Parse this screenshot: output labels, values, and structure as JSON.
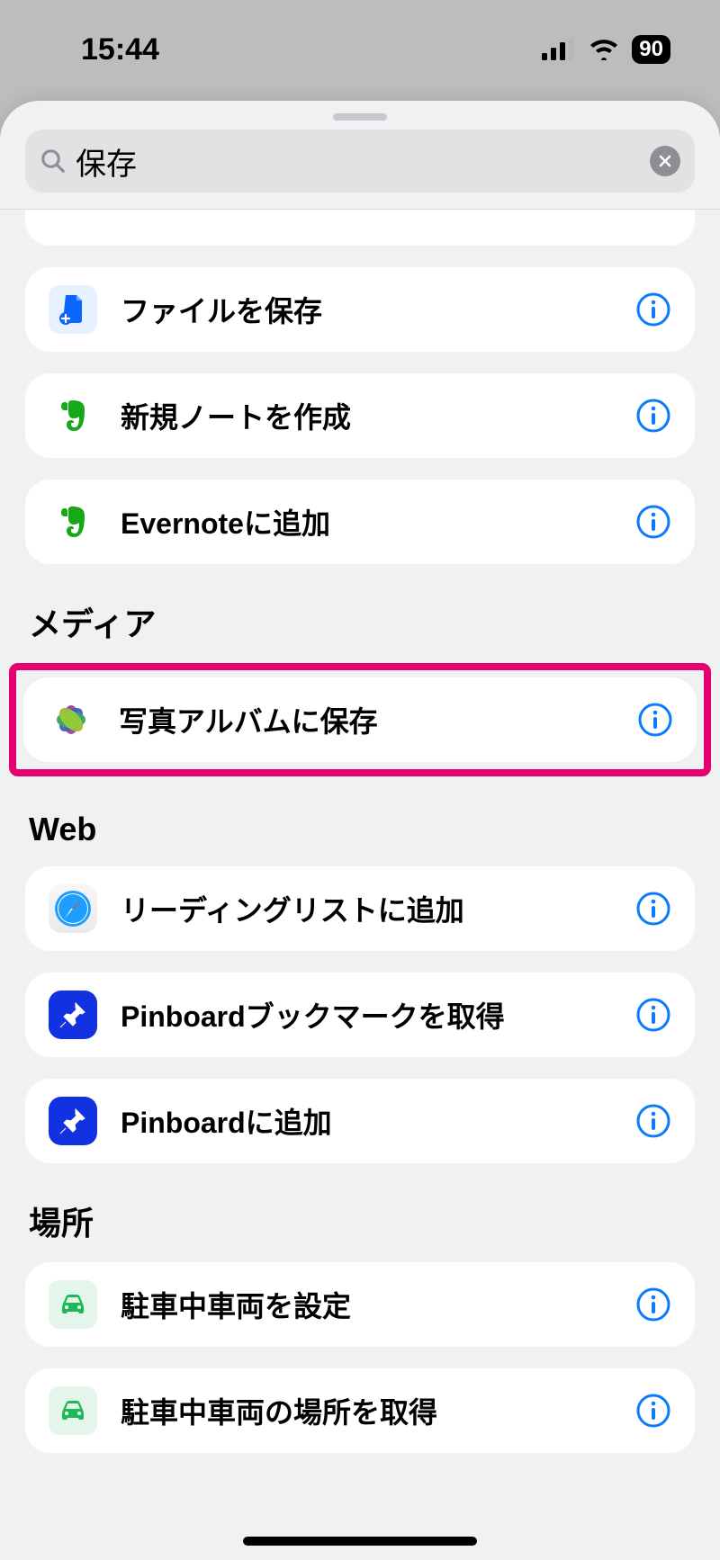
{
  "status": {
    "time": "15:44",
    "battery": "90"
  },
  "search": {
    "value": "保存"
  },
  "sections": {
    "top_items": [
      {
        "label": "ファイルを保存"
      },
      {
        "label": "新規ノートを作成"
      },
      {
        "label": "Evernoteに追加"
      }
    ],
    "media": {
      "header": "メディア",
      "item": {
        "label": "写真アルバムに保存"
      }
    },
    "web": {
      "header": "Web",
      "items": [
        {
          "label": "リーディングリストに追加"
        },
        {
          "label": "Pinboardブックマークを取得"
        },
        {
          "label": "Pinboardに追加"
        }
      ]
    },
    "location": {
      "header": "場所",
      "items": [
        {
          "label": "駐車中車両を設定"
        },
        {
          "label": "駐車中車両の場所を取得"
        }
      ]
    }
  }
}
